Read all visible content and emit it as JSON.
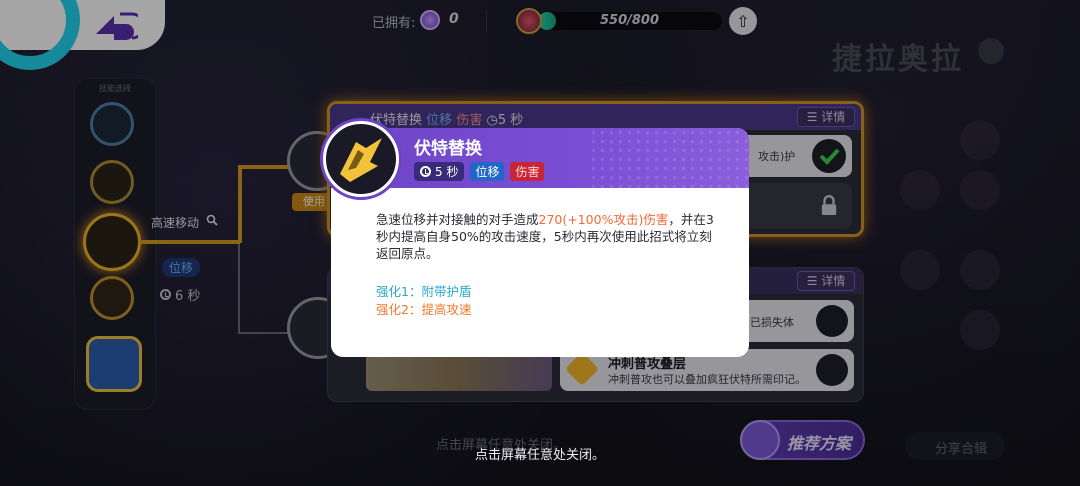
{
  "topbar": {
    "owned_label": "已拥有:",
    "owned_value": "0",
    "xp_text": "550/800",
    "xp_fraction": 0.1
  },
  "pokemon_name": "捷拉奥拉",
  "left": {
    "skill_col_header": "技能选择",
    "route_label": "高速移动",
    "route_tag": "位移",
    "route_cd": "6 秒",
    "node1_tag": "使用"
  },
  "panel_top": {
    "title": "伏特替换",
    "tag1": "位移",
    "tag2": "伤害",
    "cd": "5 秒",
    "detail_label": "详情",
    "row1_text": "攻击)护"
  },
  "panel_bot": {
    "detail_label": "详情",
    "opt1_desc": "已损失体",
    "opt2_title": "冲刺普攻叠层",
    "opt2_desc": "冲刺普攻也可以叠加疯狂伏特所需印记。"
  },
  "recommend_label": "推荐方案",
  "share_label": "分享合辑",
  "blur_close": "点击屏幕任意处关闭。",
  "tap_close": "点击屏幕任意处关闭。",
  "popup": {
    "title": "伏特替换",
    "cd": "5 秒",
    "tag1": "位移",
    "tag2": "伤害",
    "desc_a": "急速位移并对接触的对手造成",
    "desc_hl": "270(+100%攻击)伤害",
    "desc_b": "，并在3秒内提高自身50%的攻击速度，5秒内再次使用此招式将立刻返回原点。",
    "enh1": "强化1：附带护盾",
    "enh2": "强化2：提高攻速"
  },
  "colors": {
    "accent_purple": "#6e44c6",
    "gold": "#d0952a",
    "tag_blue": "#2166c8",
    "tag_red": "#c82638",
    "damage_orange": "#ef6a3a",
    "enh1_cyan": "#27a8c8",
    "enh2_orange": "#ef7a30"
  }
}
